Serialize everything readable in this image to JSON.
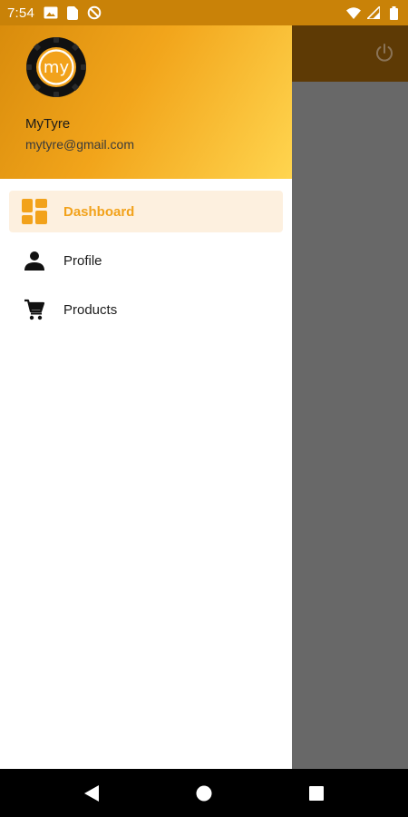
{
  "status_bar": {
    "time": "7:54",
    "left_icons": [
      "image-icon",
      "sim-card-icon",
      "no-sync-icon"
    ],
    "right_icons": [
      "wifi-icon",
      "signal-icon",
      "battery-icon"
    ]
  },
  "colors": {
    "accent": "#f2a21b",
    "status_bar": "#c98208",
    "toolbar": "#5e3a05",
    "scrim": "#686868",
    "active_item_bg": "#fdf0df"
  },
  "drawer": {
    "header": {
      "avatar_text": "my",
      "name": "MyTyre",
      "email": "mytyre@gmail.com"
    },
    "menu": [
      {
        "label": "Dashboard",
        "icon": "dashboard-icon",
        "active": true
      },
      {
        "label": "Profile",
        "icon": "person-icon",
        "active": false
      },
      {
        "label": "Products",
        "icon": "cart-icon",
        "active": false
      }
    ]
  },
  "toolbar": {
    "icon": "power-icon"
  },
  "nav_bar": {
    "buttons": [
      "back-icon",
      "home-icon",
      "recents-icon"
    ]
  }
}
